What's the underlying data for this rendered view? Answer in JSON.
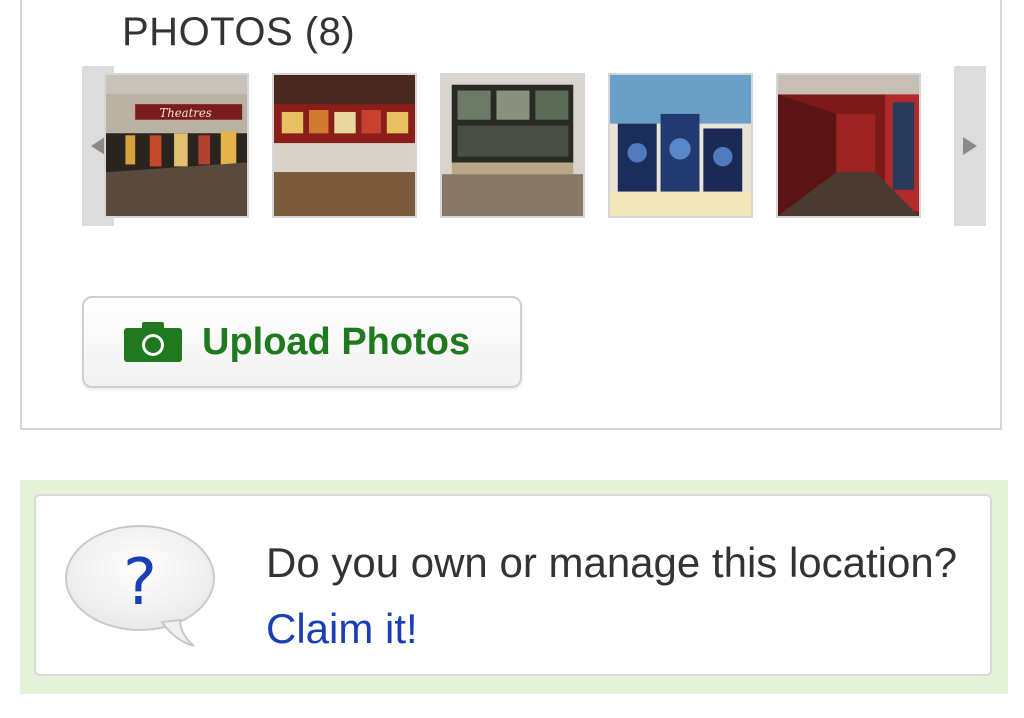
{
  "photos": {
    "title": "PHOTOS (8)",
    "prev_icon": "triangle-left-icon",
    "next_icon": "triangle-right-icon",
    "thumbnails": [
      "lobby-photo",
      "concession-photo",
      "ticket-window-photo",
      "popcorn-display-photo",
      "hallway-photo"
    ]
  },
  "upload": {
    "label": "Upload Photos",
    "icon": "camera-icon",
    "color": "#1f7a1f"
  },
  "claim": {
    "text": "Do you own or manage this location?",
    "link": "Claim it!",
    "icon": "question-bubble-icon",
    "link_color": "#1a3fb5",
    "border_color": "#e4f2d8"
  }
}
